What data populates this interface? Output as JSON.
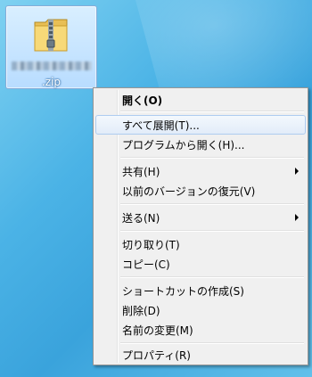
{
  "desktop_file": {
    "extension_label": ".zip"
  },
  "context_menu": {
    "items": [
      {
        "label": "開く(O)"
      },
      {
        "label": "すべて展開(T)..."
      },
      {
        "label": "プログラムから開く(H)..."
      },
      {
        "label": "共有(H)"
      },
      {
        "label": "以前のバージョンの復元(V)"
      },
      {
        "label": "送る(N)"
      },
      {
        "label": "切り取り(T)"
      },
      {
        "label": "コピー(C)"
      },
      {
        "label": "ショートカットの作成(S)"
      },
      {
        "label": "削除(D)"
      },
      {
        "label": "名前の変更(M)"
      },
      {
        "label": "プロパティ(R)"
      }
    ]
  },
  "colors": {
    "menu_background": "#f0f0f0",
    "highlight_border": "#aeccf0",
    "selection_tile": "#cfe7ff"
  }
}
